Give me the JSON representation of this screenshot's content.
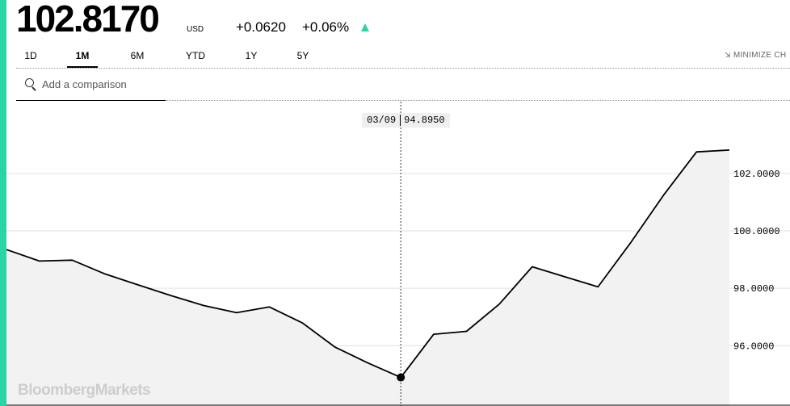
{
  "quote": {
    "price": "102.8170",
    "currency": "USD",
    "change": "+0.0620",
    "change_pct": "+0.06%"
  },
  "tabs": [
    {
      "label": "1D"
    },
    {
      "label": "1M",
      "active": true
    },
    {
      "label": "6M"
    },
    {
      "label": "YTD"
    },
    {
      "label": "1Y"
    },
    {
      "label": "5Y"
    }
  ],
  "minimize_label": "MINIMIZE CH",
  "search": {
    "placeholder": "Add a comparison"
  },
  "tooltip": {
    "date": "03/09",
    "value": "94.8950"
  },
  "watermark": "BloombergMarkets",
  "colors": {
    "accent": "#2bd4a4",
    "line": "#000000",
    "area_fill": "#f2f2f2",
    "grid": "#e0e0e0"
  },
  "chart_data": {
    "type": "area",
    "x": [
      0,
      1,
      2,
      3,
      4,
      5,
      6,
      7,
      8,
      9,
      10,
      11,
      12,
      13,
      14,
      15,
      16,
      17,
      18,
      19,
      20,
      21,
      22,
      23,
      24
    ],
    "series": [
      {
        "values": [
          99.35,
          98.95,
          98.98,
          98.5,
          98.12,
          97.75,
          97.4,
          97.15,
          97.35,
          96.8,
          95.95,
          95.4,
          94.895,
          96.4,
          96.5,
          97.45,
          98.75,
          98.4,
          98.05,
          99.6,
          101.25,
          102.75,
          102.817
        ]
      }
    ],
    "highlight": {
      "index": 12,
      "date": "03/09",
      "value": 94.895
    },
    "y_ticks": [
      {
        "value": 96,
        "label": "96.0000"
      },
      {
        "value": 98,
        "label": "98.0000"
      },
      {
        "value": 100,
        "label": "100.0000"
      },
      {
        "value": 102,
        "label": "102.0000"
      }
    ],
    "ylim": [
      93.9,
      104.5
    ],
    "grid": true,
    "axis_position": "right"
  }
}
